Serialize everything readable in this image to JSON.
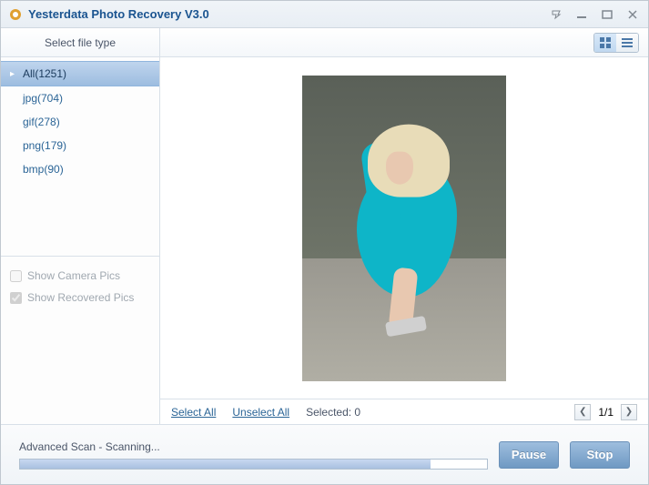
{
  "titlebar": {
    "title": "Yesterdata Photo Recovery V3.0"
  },
  "sidebar": {
    "header": "Select file type",
    "items": [
      {
        "label": "All(1251)",
        "selected": true
      },
      {
        "label": "jpg(704)",
        "selected": false
      },
      {
        "label": "gif(278)",
        "selected": false
      },
      {
        "label": "png(179)",
        "selected": false
      },
      {
        "label": "bmp(90)",
        "selected": false
      }
    ],
    "checkboxes": {
      "show_camera": {
        "label": "Show Camera Pics",
        "checked": false
      },
      "show_recovered": {
        "label": "Show Recovered Pics",
        "checked": true
      }
    }
  },
  "content": {
    "select_all": "Select All",
    "unselect_all": "Unselect All",
    "selected_label": "Selected: 0",
    "page_label": "1/1"
  },
  "footer": {
    "status": "Advanced Scan - Scanning...",
    "progress_pct": 88,
    "pause": "Pause",
    "stop": "Stop"
  }
}
